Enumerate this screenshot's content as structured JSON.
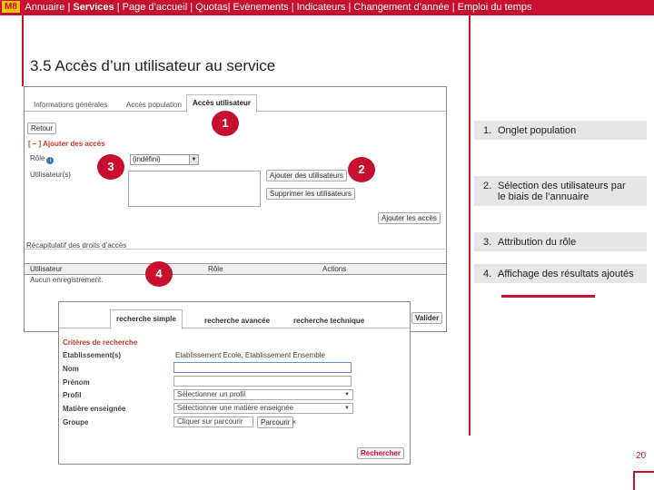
{
  "topbar": {
    "logo": "M8",
    "items": [
      {
        "label": "Annuaire |"
      },
      {
        "label": "Services"
      },
      {
        "label": "| Page d’accueil | Quotas| Evènements | Indicateurs |"
      },
      {
        "label": "Changement d’année"
      },
      {
        "label": "| Emploi du temps"
      }
    ]
  },
  "slide": {
    "title": "3.5 Accès d’un utilisateur au service",
    "page_number": "20"
  },
  "screenshot1": {
    "tabs": [
      "Informations générales",
      "Accès population",
      "Accès utilisateur"
    ],
    "back_button": "Retour",
    "add_access_link": "[ – ] Ajouter des accès",
    "role_label": "Rôle",
    "role_value": "(indéfini)",
    "users_label": "Utilisateur(s)",
    "add_users_button": "Ajouter des utilisateurs",
    "remove_users_button": "Supprimer les utilisateurs",
    "add_access_button": "Ajouter les accès",
    "recap_title": "Récapitulatif des droits d’accès",
    "table": {
      "columns": [
        "Utilisateur",
        "Rôle",
        "Actions"
      ],
      "empty_row": "Aucun enregistrement."
    },
    "validate_button": "Valider"
  },
  "screenshot2": {
    "tabs": [
      "recherche simple",
      "recherche avancée",
      "recherche technique"
    ],
    "criteria_title": "Critères de recherche",
    "fields": [
      {
        "label": "Etablissement(s)",
        "value": "Etablissement Ecole, Etablissement Ensemble"
      },
      {
        "label": "Nom",
        "value": ""
      },
      {
        "label": "Prénom",
        "value": ""
      },
      {
        "label": "Profil",
        "value": "Sélectionner un profil"
      },
      {
        "label": "Matière enseignée",
        "value": "Sélectionner une matière enseignée"
      },
      {
        "label": "Groupe",
        "value": "Cliquer sur parcourir"
      }
    ],
    "browse_button": "Parcourir",
    "clear_glyph": "×",
    "search_button": "Rechercher"
  },
  "markers": [
    "1",
    "2",
    "3",
    "4"
  ],
  "steps": [
    {
      "num": "1.",
      "text": "Onglet population"
    },
    {
      "num": "2.",
      "text": "Sélection des utilisateurs par le biais de l’annuaire"
    },
    {
      "num": "3.",
      "text": "Attribution du rôle"
    },
    {
      "num": "4.",
      "text": "Affichage des résultats ajoutés"
    }
  ],
  "colors": {
    "accent": "#c8102e",
    "logo_bg": "#f2c300",
    "step_bg": "#e6e6e6"
  },
  "icons": [
    "info-icon",
    "dropdown-arrow-icon"
  ]
}
